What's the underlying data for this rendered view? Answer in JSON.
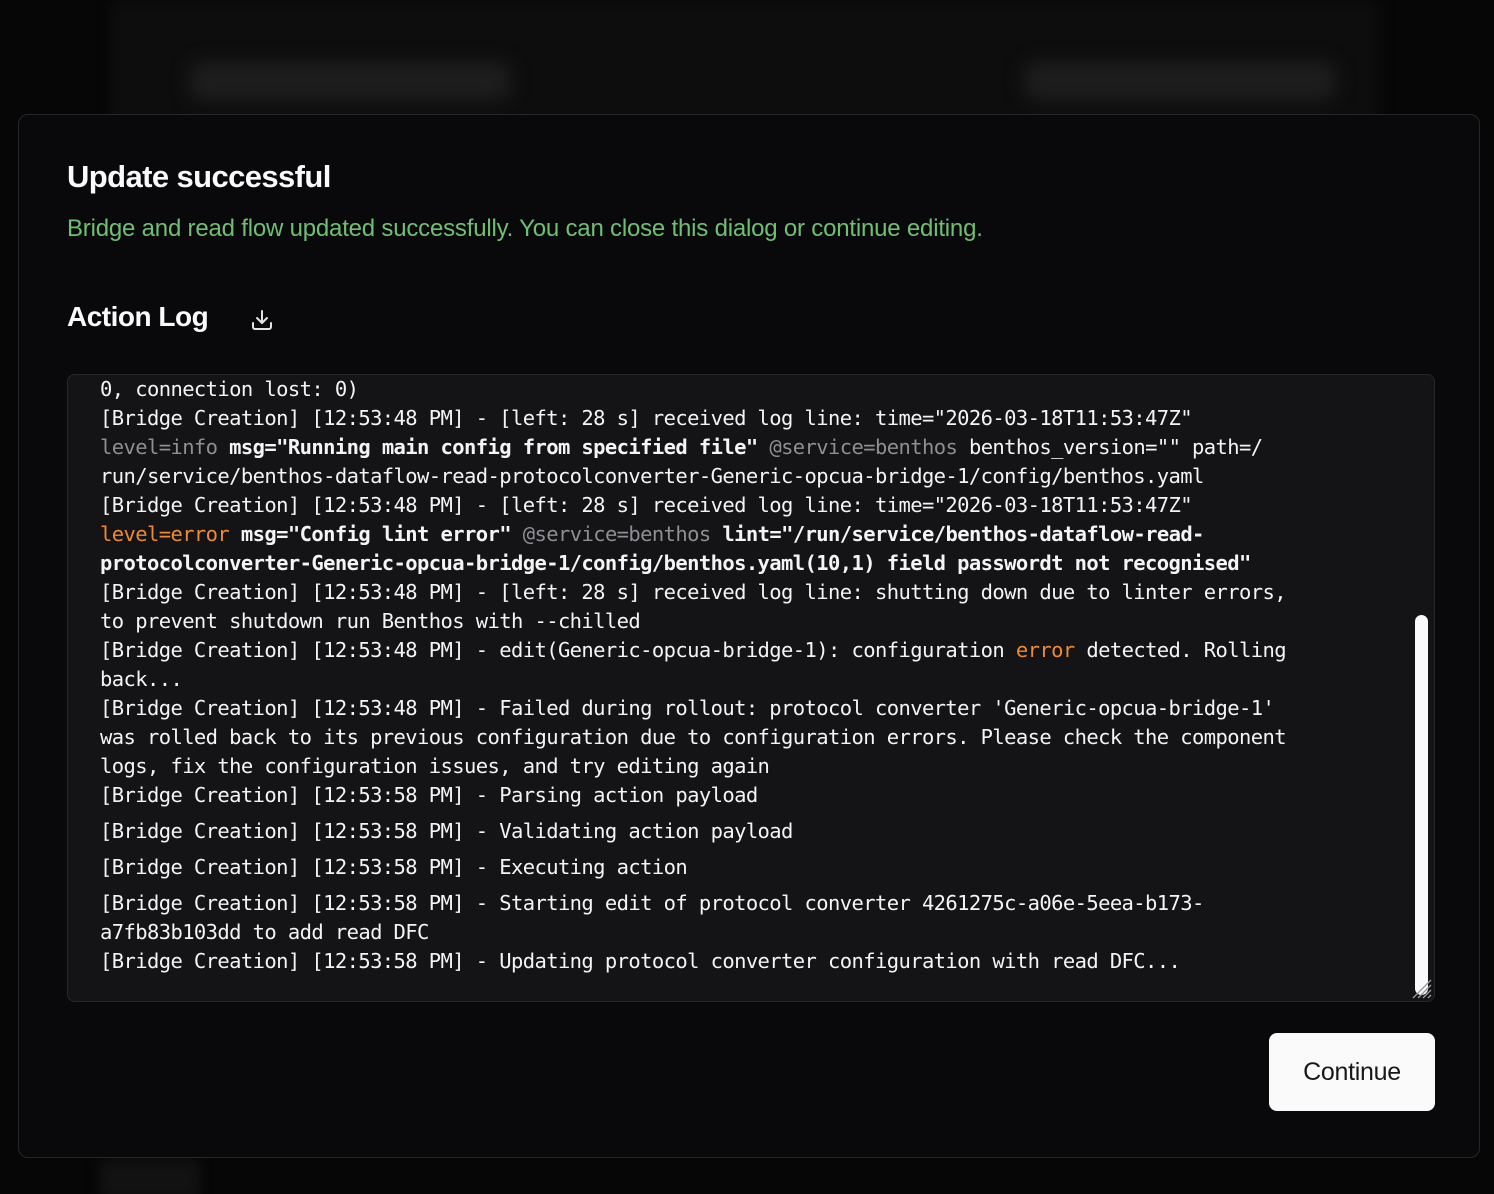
{
  "dialog": {
    "title": "Update successful",
    "description": "Bridge and read flow updated successfully. You can close this dialog or continue editing.",
    "description_color": "#6fbf73"
  },
  "action_log": {
    "heading": "Action Log",
    "download_icon": "download-icon",
    "lines": {
      "l01": "0, connection lost: 0)",
      "l02": "[Bridge Creation] [12:53:48 PM] - [left: 28 s] received log line: time=\"2026-03-18T11:53:47Z\"",
      "l03a": "level=info",
      "l03b": "msg=\"Running main config from specified file\"",
      "l03c": "@service=benthos",
      "l03d": "benthos_version=\"\" path=/",
      "l04": "run/service/benthos-dataflow-read-protocolconverter-Generic-opcua-bridge-1/config/benthos.yaml",
      "l05": "[Bridge Creation] [12:53:48 PM] - [left: 28 s] received log line: time=\"2026-03-18T11:53:47Z\"",
      "l06a": "level=error",
      "l06b": "msg=\"Config lint error\"",
      "l06c": "@service=benthos",
      "l06d": "lint=\"/run/service/benthos-dataflow-read-",
      "l07": "protocolconverter-Generic-opcua-bridge-1/config/benthos.yaml(10,1) field passwordt not recognised\"",
      "l08": "[Bridge Creation] [12:53:48 PM] - [left: 28 s] received log line: shutting down due to linter errors,",
      "l09": "to prevent shutdown run Benthos with --chilled",
      "l10a": "[Bridge Creation] [12:53:48 PM] - edit(Generic-opcua-bridge-1): configuration",
      "l10b": "error",
      "l10c": "detected. Rolling",
      "l11": "back...",
      "l12": "[Bridge Creation] [12:53:48 PM] - Failed during rollout: protocol converter 'Generic-opcua-bridge-1'",
      "l13": "was rolled back to its previous configuration due to configuration errors. Please check the component",
      "l14": "logs, fix the configuration issues, and try editing again",
      "l15": "[Bridge Creation] [12:53:58 PM] - Parsing action payload",
      "l16": "[Bridge Creation] [12:53:58 PM] - Validating action payload",
      "l17": "[Bridge Creation] [12:53:58 PM] - Executing action",
      "l18": "[Bridge Creation] [12:53:58 PM] - Starting edit of protocol converter 4261275c-a06e-5eea-b173-",
      "l19": "a7fb83b103dd to add read DFC",
      "l20": "[Bridge Creation] [12:53:58 PM] - Updating protocol converter configuration with read DFC..."
    },
    "colors": {
      "error": "#f08a2e",
      "dim": "#8e8e93"
    }
  },
  "footer": {
    "continue_label": "Continue"
  }
}
